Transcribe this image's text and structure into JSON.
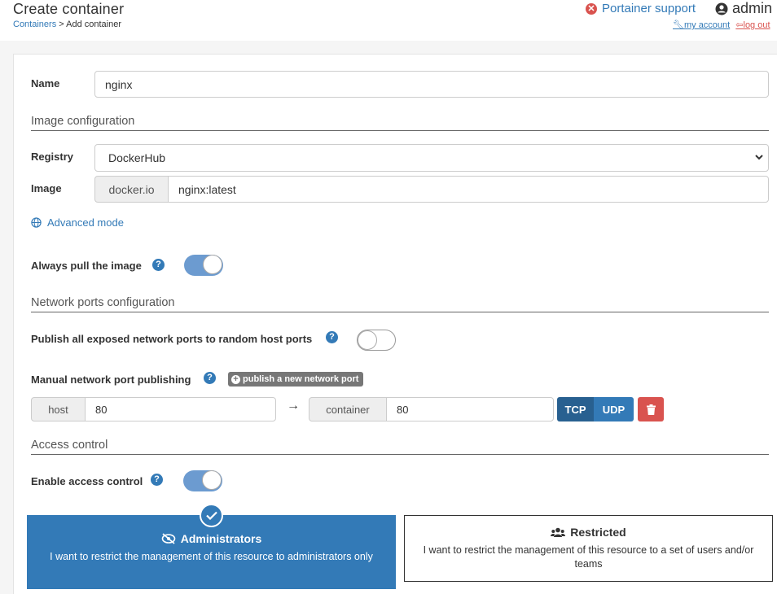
{
  "header": {
    "title": "Create container",
    "breadcrumb": {
      "parent": "Containers",
      "separator": " > ",
      "current": "Add container"
    },
    "support_label": "Portainer support",
    "username": "admin",
    "my_account": "my account",
    "log_out": "log out"
  },
  "form": {
    "name_label": "Name",
    "name_value": "nginx",
    "image_section": "Image configuration",
    "registry_label": "Registry",
    "registry_value": "DockerHub",
    "image_label": "Image",
    "image_prefix": "docker.io",
    "image_value": "nginx:latest",
    "advanced_mode": "Advanced mode",
    "always_pull_label": "Always pull the image",
    "always_pull_on": true,
    "ports_section": "Network ports configuration",
    "publish_all_label": "Publish all exposed network ports to random host ports",
    "publish_all_on": false,
    "manual_label": "Manual network port publishing",
    "publish_new_label": "publish a new network port",
    "port_mapping": {
      "host_label": "host",
      "host_value": "80",
      "arrow": "→",
      "container_label": "container",
      "container_value": "80",
      "protocols": [
        "TCP",
        "UDP"
      ],
      "selected_protocol": "TCP"
    },
    "access_section": "Access control",
    "enable_access_label": "Enable access control",
    "enable_access_on": true,
    "access_options": {
      "admin_title": "Administrators",
      "admin_desc": "I want to restrict the management of this resource to administrators only",
      "restricted_title": "Restricted",
      "restricted_desc": "I want to restrict the management of this resource to a set of users and/or teams",
      "selected": "Administrators"
    }
  },
  "colors": {
    "primary": "#337ab7",
    "primary_dark": "#286090",
    "danger": "#d9534f",
    "toggle_on": "#6c9bd0"
  }
}
